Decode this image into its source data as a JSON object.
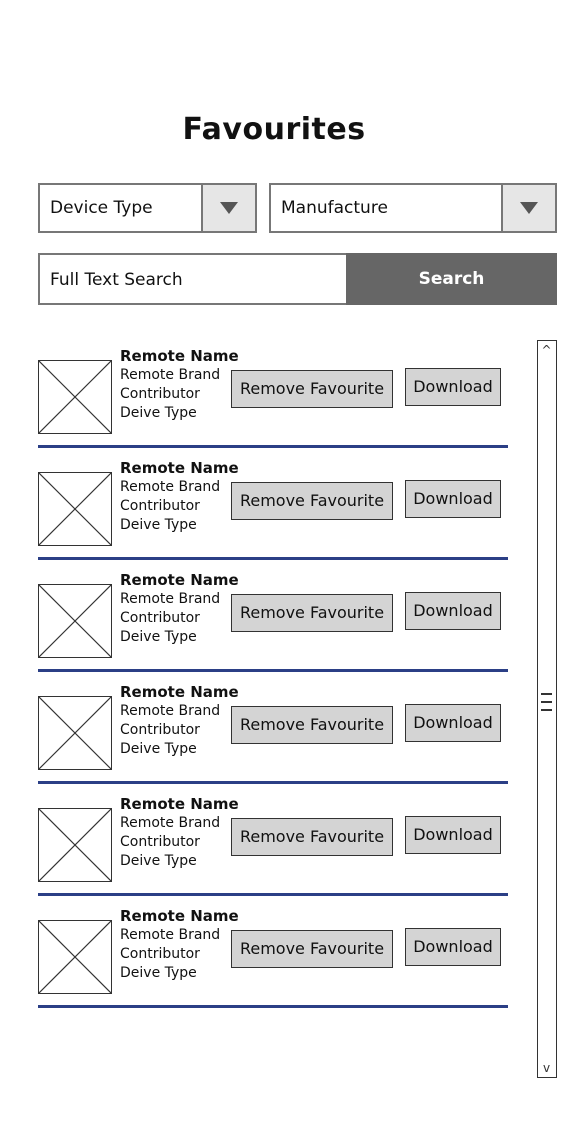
{
  "page": {
    "title": "Favourites"
  },
  "filters": {
    "device_type": {
      "label": "Device Type",
      "icon": "chevron-down-icon"
    },
    "manufacture": {
      "label": "Manufacture",
      "icon": "chevron-down-icon"
    }
  },
  "search": {
    "placeholder": "Full Text Search",
    "button_label": "Search"
  },
  "items": [
    {
      "name": "Remote Name",
      "brand": "Remote Brand",
      "contributor": "Contributor",
      "device_type": "Deive Type",
      "remove_label": "Remove Favourite",
      "download_label": "Download"
    },
    {
      "name": "Remote Name",
      "brand": "Remote Brand",
      "contributor": "Contributor",
      "device_type": "Deive Type",
      "remove_label": "Remove Favourite",
      "download_label": "Download"
    },
    {
      "name": "Remote Name",
      "brand": "Remote Brand",
      "contributor": "Contributor",
      "device_type": "Deive Type",
      "remove_label": "Remove Favourite",
      "download_label": "Download"
    },
    {
      "name": "Remote Name",
      "brand": "Remote Brand",
      "contributor": "Contributor",
      "device_type": "Deive Type",
      "remove_label": "Remove Favourite",
      "download_label": "Download"
    },
    {
      "name": "Remote Name",
      "brand": "Remote Brand",
      "contributor": "Contributor",
      "device_type": "Deive Type",
      "remove_label": "Remove Favourite",
      "download_label": "Download"
    },
    {
      "name": "Remote Name",
      "brand": "Remote Brand",
      "contributor": "Contributor",
      "device_type": "Deive Type",
      "remove_label": "Remove Favourite",
      "download_label": "Download"
    }
  ],
  "scrollbar": {
    "up_glyph": "^",
    "down_glyph": "v"
  },
  "colors": {
    "divider": "#2b3f86",
    "search_button_bg": "#666666",
    "button_bg": "#d4d4d4"
  }
}
